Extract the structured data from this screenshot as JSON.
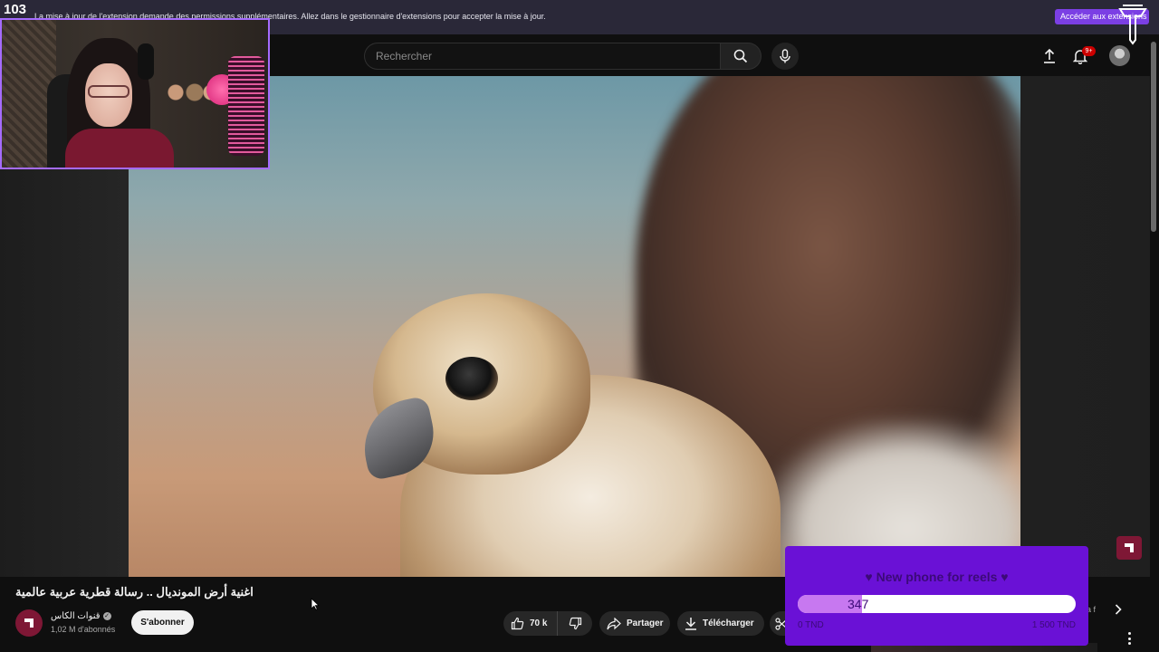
{
  "stream": {
    "viewer_count": "103"
  },
  "extension_banner": {
    "message": "La mise à jour de l'extension demande des permissions supplémentaires. Allez dans le gestionnaire d'extensions pour accepter la mise à jour.",
    "button_label": "Accéder aux extensions"
  },
  "header": {
    "search_placeholder": "Rechercher",
    "notification_badge": "9+"
  },
  "video": {
    "title": "اغنية أرض المونديال .. رسالة قطرية عربية عالمية",
    "channel_name": "قنوات الكاس",
    "subscribers": "1,02 M d'abonnés",
    "subscribe_label": "S'abonner",
    "likes": "70 k",
    "share_label": "Partager",
    "download_label": "Télécharger"
  },
  "sidebar_partial": {
    "text": "a f"
  },
  "donation_goal": {
    "title": "♥ New phone for reels ♥",
    "current": "347",
    "min_label": "0 TND",
    "max_label": "1 500 TND",
    "progress_fraction": 0.23
  },
  "colors": {
    "accent_purple": "#6a11d6",
    "ext_button": "#7b3fe4",
    "channel_red": "#7e1735",
    "webcam_border": "#a56bff"
  }
}
